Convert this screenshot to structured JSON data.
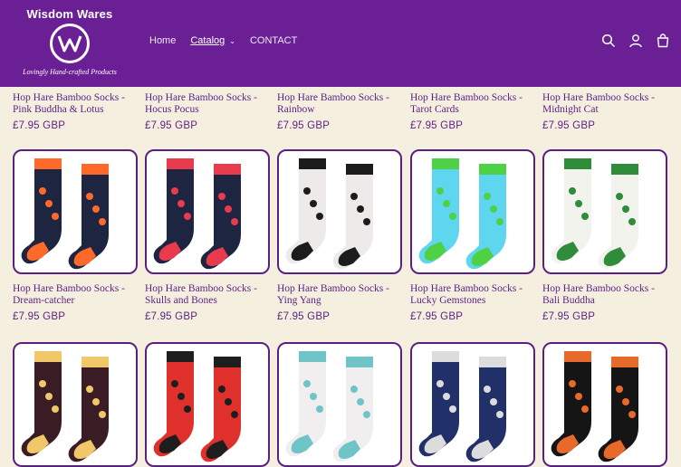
{
  "header": {
    "brand": "Wisdom Wares",
    "tagline": "Lovingly Hand-crafted Products",
    "nav": [
      {
        "label": "Home"
      },
      {
        "label": "Catalog"
      },
      {
        "label": "CONTACT"
      }
    ],
    "icons": [
      "search-icon",
      "account-icon",
      "cart-icon"
    ]
  },
  "products": [
    {
      "title": "Hop Hare Bamboo Socks - Pink Buddha & Lotus",
      "price": "£7.95 GBP",
      "colors": [
        "#ff7a33",
        "#2a2a2a"
      ]
    },
    {
      "title": "Hop Hare Bamboo Socks - Hocus Pocus",
      "price": "£7.95 GBP",
      "colors": [
        "#1e2540",
        "#f0b64a"
      ]
    },
    {
      "title": "Hop Hare Bamboo Socks - Rainbow",
      "price": "£7.95 GBP",
      "colors": [
        "#2b3a8c",
        "#e44a3c"
      ]
    },
    {
      "title": "Hop Hare Bamboo Socks - Tarot Cards",
      "price": "£7.95 GBP",
      "colors": [
        "#f2cc6b",
        "#7a2414"
      ]
    },
    {
      "title": "Hop Hare Bamboo Socks - Midnight Cat",
      "price": "£7.95 GBP",
      "colors": [
        "#27316e",
        "#f3d27a"
      ]
    },
    {
      "title": "Hop Hare Bamboo Socks - Dream-catcher",
      "price": "£7.95 GBP",
      "colors": [
        "#1e2540",
        "#ff6a2b"
      ]
    },
    {
      "title": "Hop Hare Bamboo Socks - Skulls and Bones",
      "price": "£7.95 GBP",
      "colors": [
        "#1e2540",
        "#e83b4e"
      ]
    },
    {
      "title": "Hop Hare Bamboo Socks - Ying Yang",
      "price": "£7.95 GBP",
      "colors": [
        "#eeeaea",
        "#1c1c1c"
      ]
    },
    {
      "title": "Hop Hare Bamboo Socks - Lucky Gemstones",
      "price": "£7.95 GBP",
      "colors": [
        "#5fd6ef",
        "#4fd146"
      ]
    },
    {
      "title": "Hop Hare Bamboo Socks - Bali Buddha",
      "price": "£7.95 GBP",
      "colors": [
        "#f3f3ee",
        "#2e8c3a"
      ]
    },
    {
      "title": "",
      "price": "",
      "colors": [
        "#3a1c24",
        "#f0c86a"
      ]
    },
    {
      "title": "",
      "price": "",
      "colors": [
        "#e0302c",
        "#1e1e1e"
      ]
    },
    {
      "title": "",
      "price": "",
      "colors": [
        "#f1eef0",
        "#6fc4c8"
      ]
    },
    {
      "title": "",
      "price": "",
      "colors": [
        "#22306a",
        "#dcdcdc"
      ]
    },
    {
      "title": "",
      "price": "",
      "colors": [
        "#151515",
        "#e86a2a"
      ]
    }
  ]
}
